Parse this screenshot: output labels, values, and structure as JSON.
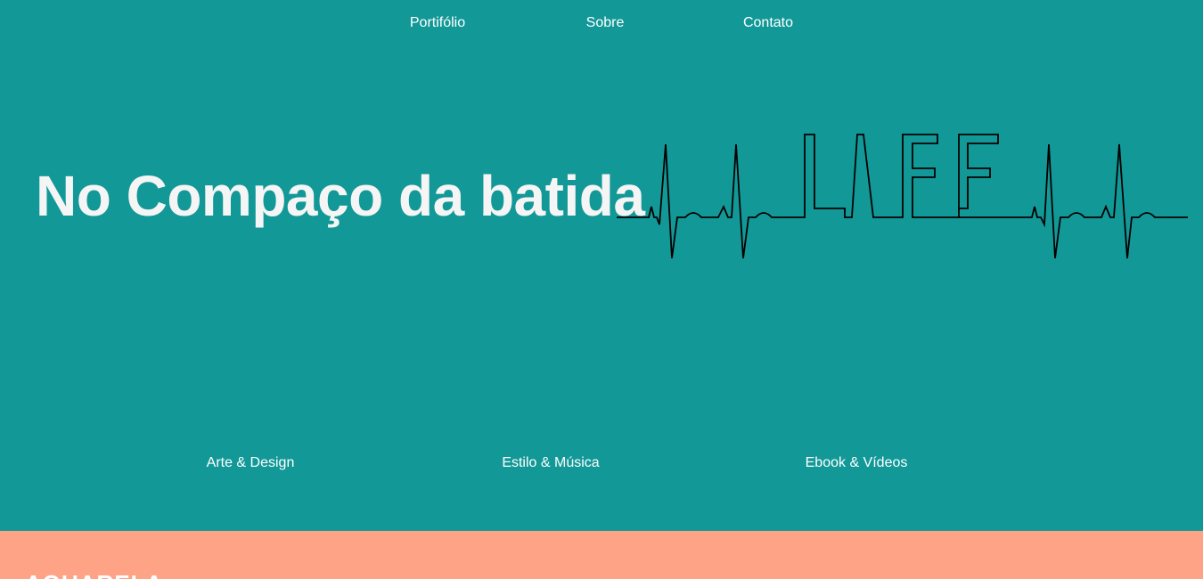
{
  "nav": {
    "portfolio": "Portifólio",
    "about": "Sobre",
    "contact": "Contato"
  },
  "hero": {
    "headline": "No Compaço da batida",
    "art_icon": "heartbeat-life-icon"
  },
  "categories": {
    "art": "Arte & Design",
    "style": "Estilo & Música",
    "ebook": "Ebook & Vídeos"
  },
  "section2": {
    "title": "AQUARELA"
  },
  "colors": {
    "hero_bg": "#139898",
    "section2_bg": "#ffa387",
    "text": "#ffffff",
    "line": "#000000"
  }
}
